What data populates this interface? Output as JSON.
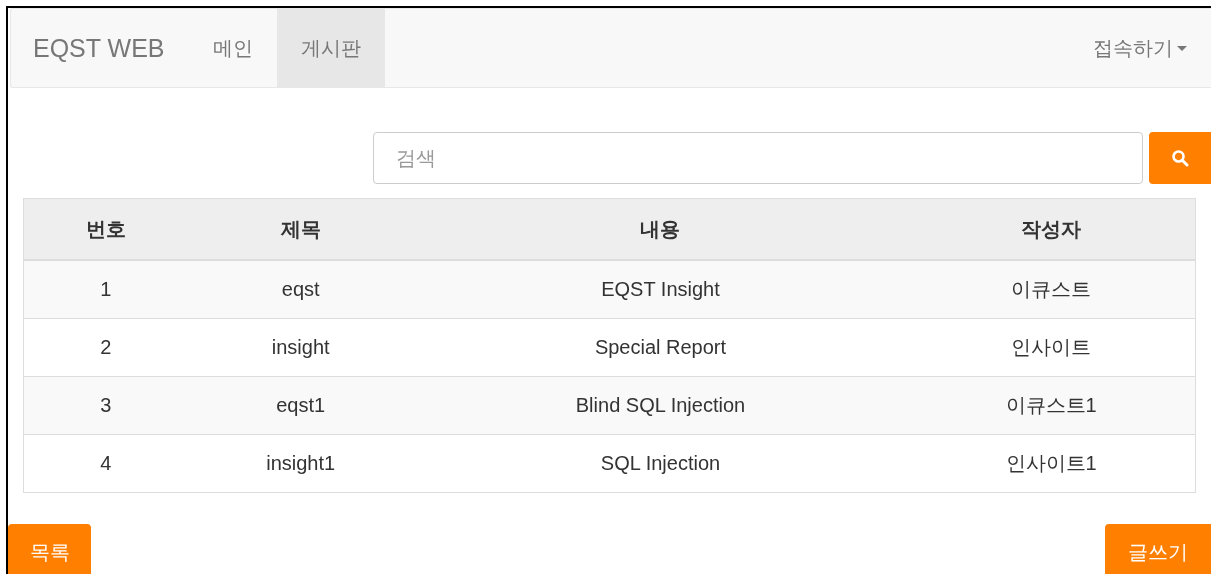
{
  "navbar": {
    "brand": "EQST WEB",
    "items": [
      {
        "label": "메인",
        "selected": false
      },
      {
        "label": "게시판",
        "selected": true
      }
    ],
    "dropdown": {
      "label": "접속하기"
    }
  },
  "search": {
    "placeholder": "검색"
  },
  "table": {
    "columns": [
      "번호",
      "제목",
      "내용",
      "작성자"
    ],
    "rows": [
      [
        "1",
        "eqst",
        "EQST Insight",
        "이큐스트"
      ],
      [
        "2",
        "insight",
        "Special Report",
        "인사이트"
      ],
      [
        "3",
        "eqst1",
        "Blind SQL Injection",
        "이큐스트1"
      ],
      [
        "4",
        "insight1",
        "SQL Injection",
        "인사이트1"
      ]
    ]
  },
  "buttons": {
    "list": "목록",
    "write": "글쓰기"
  }
}
